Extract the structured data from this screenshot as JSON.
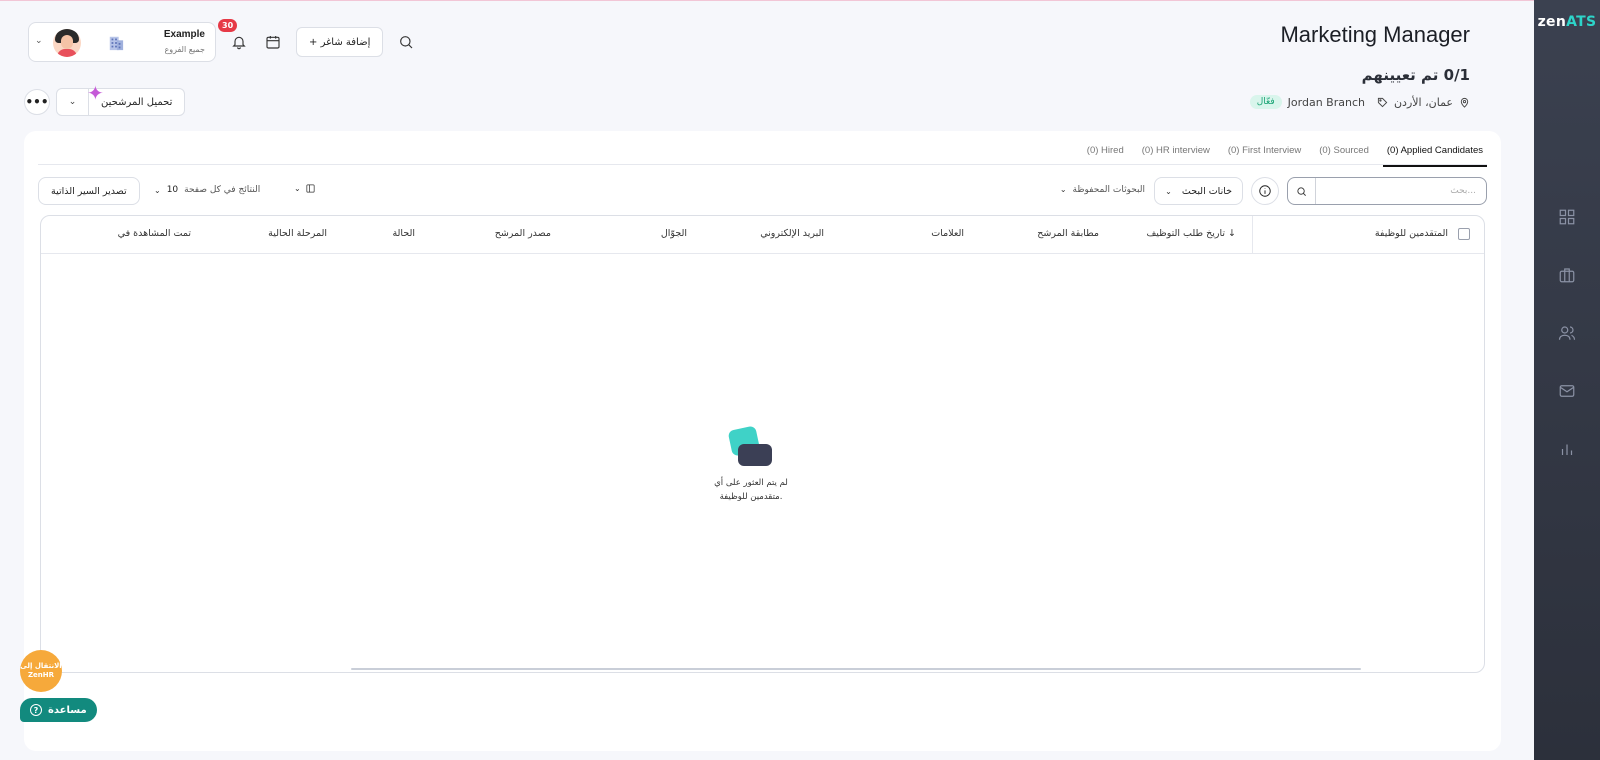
{
  "sidebar": {
    "logo_prefix": "zen",
    "logo_suffix": "ATS",
    "icons": [
      "dashboard-icon",
      "briefcase-icon",
      "users-icon",
      "mail-icon",
      "reports-icon"
    ]
  },
  "header": {
    "job_title": "Marketing Manager",
    "assigned": "0/1 تم تعيينهم",
    "location": "عمان، الأردن",
    "branch": "Jordan Branch",
    "status": "فعّال",
    "add_vacancy": "+ إضافة شاغر",
    "notifications_count": "30",
    "profile_name": "Example",
    "profile_sub": "جميع الفروع",
    "upload_candidates": "تحميل المرشحين",
    "more": "•••"
  },
  "tabs": [
    {
      "label": "(0) Applied Candidates",
      "active": true
    },
    {
      "label": "(0) Sourced"
    },
    {
      "label": "(0) First Interview"
    },
    {
      "label": "(0) HR interview"
    },
    {
      "label": "(0) Hired"
    }
  ],
  "filters": {
    "search_placeholder": "بحث...",
    "search_fields": "خانات البحث",
    "saved_searches": "البحوثات المحفوظة",
    "per_page_label": "النتائج في كل صفحة",
    "per_page_value": "10",
    "export": "تصدير السير الذاتية"
  },
  "table": {
    "first_col": "المتقدمين للوظيفة",
    "columns": [
      "تاريخ طلب التوظيف ↓",
      "مطابقة المرشح",
      "العلامات",
      "البريد الإلكتروني",
      "الجوّال",
      "مصدر المرشح",
      "الحالة",
      "المرحلة الحالية",
      "تمت المشاهدة في"
    ],
    "empty_line1": "لم يتم العثور على أي",
    "empty_line2": "متقدمين للوظيفة."
  },
  "floating": {
    "zenhr_line1": "الانتقال إلى",
    "zenhr_line2": "ZenHR",
    "help": "مساعدة"
  },
  "colors": {
    "sidebar": "#2c303b",
    "accent": "#2dd4c9",
    "badge": "#19a374",
    "notif": "#e63946",
    "help": "#128a7e",
    "zenhr": "#f6a93b"
  }
}
